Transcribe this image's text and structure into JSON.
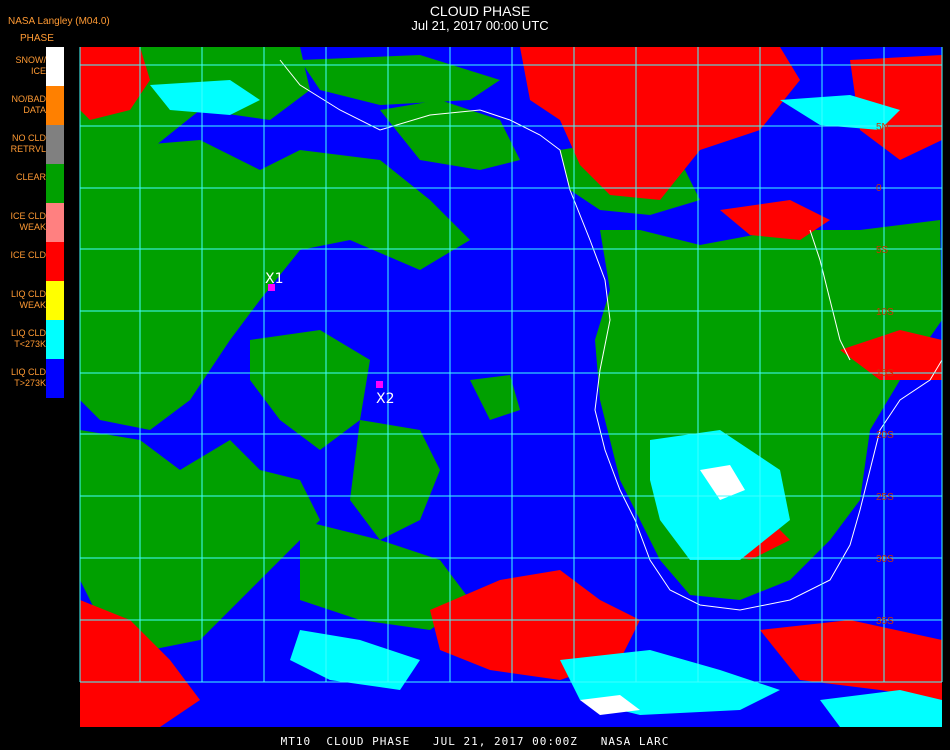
{
  "header": {
    "producer": "NASA Langley (M04.0)",
    "title": "CLOUD PHASE",
    "subtitle": "Jul 21, 2017 00:00 UTC"
  },
  "legend": {
    "title": "PHASE",
    "items": [
      {
        "label": "SNOW/\nICE",
        "color": "#ffffff"
      },
      {
        "label": "NO/BAD\nDATA",
        "color": "#ff8000"
      },
      {
        "label": "NO CLD\nRETRVL",
        "color": "#808080"
      },
      {
        "label": "CLEAR",
        "color": "#00a000"
      },
      {
        "label": "ICE CLD\nWEAK",
        "color": "#ff8080"
      },
      {
        "label": "ICE CLD",
        "color": "#ff0000"
      },
      {
        "label": "LIQ CLD\nWEAK",
        "color": "#ffff00"
      },
      {
        "label": "LIQ CLD\nT<273K",
        "color": "#00ffff"
      },
      {
        "label": "LIQ CLD\nT>273K",
        "color": "#0000ff"
      }
    ]
  },
  "markers": [
    {
      "label": "X1",
      "color": "#ff00ff"
    },
    {
      "label": "X2",
      "color": "#ff00ff"
    }
  ],
  "lat_labels": [
    "5N",
    "0",
    "5S",
    "10S",
    "15S",
    "20S",
    "25S",
    "30S",
    "35S"
  ],
  "footer": "MT10  CLOUD PHASE   JUL 21, 2017 00:00Z   NASA LARC",
  "colors": {
    "background": "#000000",
    "grid": "#40ffff",
    "coastline": "#ffffff",
    "clear": "#00a000",
    "ice": "#ff0000",
    "liquid_warm": "#0000ff",
    "liquid_cold": "#00ffff",
    "text_label": "#ff9a33"
  }
}
